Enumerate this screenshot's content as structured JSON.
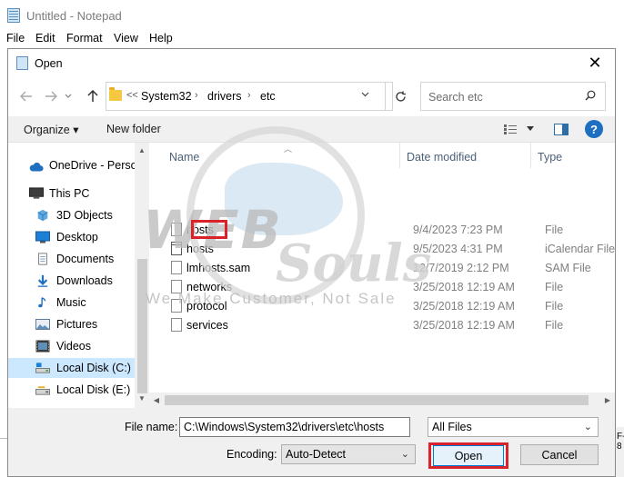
{
  "notepad": {
    "title": "Untitled - Notepad",
    "menu": [
      "File",
      "Edit",
      "Format",
      "View",
      "Help"
    ],
    "edge_text": "F-8"
  },
  "dialog": {
    "title": "Open",
    "close_glyph": "✕"
  },
  "address": {
    "overflow": "<<",
    "segments": [
      "System32",
      "drivers",
      "etc"
    ]
  },
  "search": {
    "placeholder": "Search etc"
  },
  "toolbar": {
    "organize_label": "Organize ▾",
    "new_folder_label": "New folder",
    "help_label": "?"
  },
  "nav": {
    "items": [
      {
        "label": "OneDrive - Personal",
        "icon": "cloud-icon"
      },
      {
        "label": "This PC",
        "icon": "computer-icon"
      },
      {
        "label": "3D Objects",
        "icon": "cube-icon"
      },
      {
        "label": "Desktop",
        "icon": "desktop-icon"
      },
      {
        "label": "Documents",
        "icon": "documents-icon"
      },
      {
        "label": "Downloads",
        "icon": "download-icon"
      },
      {
        "label": "Music",
        "icon": "music-icon"
      },
      {
        "label": "Pictures",
        "icon": "pictures-icon"
      },
      {
        "label": "Videos",
        "icon": "videos-icon"
      },
      {
        "label": "Local Disk (C:)",
        "icon": "drive-icon"
      },
      {
        "label": "Local Disk (E:)",
        "icon": "drive-icon"
      }
    ]
  },
  "columns": {
    "name": "Name",
    "date": "Date modified",
    "type": "Type"
  },
  "files": [
    {
      "name": "hosts",
      "date": "9/4/2023 7:23 PM",
      "type": "File"
    },
    {
      "name": "hosts",
      "date": "9/5/2023 4:31 PM",
      "type": "iCalendar File"
    },
    {
      "name": "lmhosts.sam",
      "date": "12/7/2019 2:12 PM",
      "type": "SAM File"
    },
    {
      "name": "networks",
      "date": "3/25/2018 12:19 AM",
      "type": "File"
    },
    {
      "name": "protocol",
      "date": "3/25/2018 12:19 AM",
      "type": "File"
    },
    {
      "name": "services",
      "date": "3/25/2018 12:19 AM",
      "type": "File"
    }
  ],
  "watermark": {
    "web": "WEB",
    "souls": "Souls",
    "tagline": "We Make Customer, Not Sale"
  },
  "bottom": {
    "file_name_label": "File name:",
    "file_name_value": "C:\\Windows\\System32\\drivers\\etc\\hosts",
    "filter_value": "All Files",
    "encoding_label": "Encoding:",
    "encoding_value": "Auto-Detect",
    "open_label": "Open",
    "cancel_label": "Cancel"
  }
}
